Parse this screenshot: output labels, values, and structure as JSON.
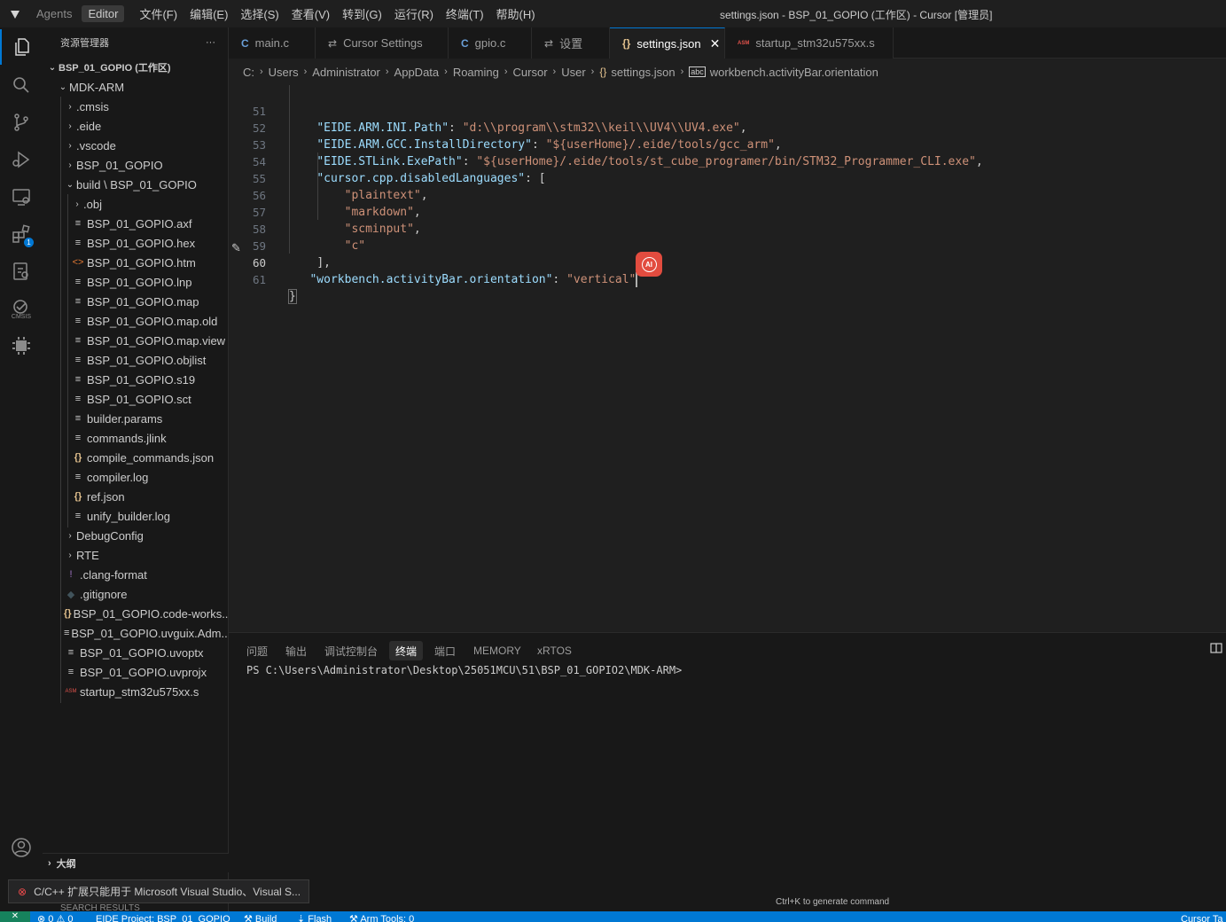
{
  "titlebar": {
    "modes": [
      "Agents",
      "Editor"
    ],
    "menus": [
      "文件(F)",
      "编辑(E)",
      "选择(S)",
      "查看(V)",
      "转到(G)",
      "运行(R)",
      "终端(T)",
      "帮助(H)"
    ],
    "window_title": "settings.json - BSP_01_GOPIO (工作区) - Cursor [管理员]"
  },
  "activitybar": {
    "items": [
      "explorer-icon",
      "search-icon",
      "source-control-icon",
      "run-debug-icon",
      "remote-explorer-icon",
      "extensions-icon",
      "eide-icon",
      "cmsis-icon",
      "chip-icon",
      "account-icon"
    ],
    "extensions_badge": "1",
    "cmsis_label": "CMSIS"
  },
  "sidebar": {
    "title": "资源管理器",
    "more": "···",
    "workspace": "BSP_01_GOPIO (工作区)",
    "tree": [
      {
        "label": "MDK-ARM",
        "chev": "⌄",
        "icon": ""
      },
      {
        "label": ".cmsis",
        "chev": "›",
        "icon": ""
      },
      {
        "label": ".eide",
        "chev": "›",
        "icon": ""
      },
      {
        "label": ".vscode",
        "chev": "›",
        "icon": ""
      },
      {
        "label": "BSP_01_GOPIO",
        "chev": "›",
        "icon": ""
      },
      {
        "label": "build \\ BSP_01_GOPIO",
        "chev": "⌄",
        "icon": ""
      },
      {
        "label": ".obj",
        "chev": "›",
        "icon": ""
      },
      {
        "label": "BSP_01_GOPIO.axf",
        "chev": "",
        "icon": "≡"
      },
      {
        "label": "BSP_01_GOPIO.hex",
        "chev": "",
        "icon": "≡"
      },
      {
        "label": "BSP_01_GOPIO.htm",
        "chev": "",
        "icon": "<>"
      },
      {
        "label": "BSP_01_GOPIO.lnp",
        "chev": "",
        "icon": "≡"
      },
      {
        "label": "BSP_01_GOPIO.map",
        "chev": "",
        "icon": "≡"
      },
      {
        "label": "BSP_01_GOPIO.map.old",
        "chev": "",
        "icon": "≡"
      },
      {
        "label": "BSP_01_GOPIO.map.view",
        "chev": "",
        "icon": "≡"
      },
      {
        "label": "BSP_01_GOPIO.objlist",
        "chev": "",
        "icon": "≡"
      },
      {
        "label": "BSP_01_GOPIO.s19",
        "chev": "",
        "icon": "≡"
      },
      {
        "label": "BSP_01_GOPIO.sct",
        "chev": "",
        "icon": "≡"
      },
      {
        "label": "builder.params",
        "chev": "",
        "icon": "≡"
      },
      {
        "label": "commands.jlink",
        "chev": "",
        "icon": "≡"
      },
      {
        "label": "compile_commands.json",
        "chev": "",
        "icon": "{}"
      },
      {
        "label": "compiler.log",
        "chev": "",
        "icon": "≡"
      },
      {
        "label": "ref.json",
        "chev": "",
        "icon": "{}"
      },
      {
        "label": "unify_builder.log",
        "chev": "",
        "icon": "≡"
      },
      {
        "label": "DebugConfig",
        "chev": "›",
        "icon": ""
      },
      {
        "label": "RTE",
        "chev": "›",
        "icon": ""
      },
      {
        "label": ".clang-format",
        "chev": "",
        "icon": "!"
      },
      {
        "label": ".gitignore",
        "chev": "",
        "icon": "◆"
      },
      {
        "label": "BSP_01_GOPIO.code-works...",
        "chev": "",
        "icon": "{}"
      },
      {
        "label": "BSP_01_GOPIO.uvguix.Adm...",
        "chev": "",
        "icon": "≡"
      },
      {
        "label": "BSP_01_GOPIO.uvoptx",
        "chev": "",
        "icon": "≡"
      },
      {
        "label": "BSP_01_GOPIO.uvprojx",
        "chev": "",
        "icon": "≡"
      },
      {
        "label": "startup_stm32u575xx.s",
        "chev": "",
        "icon": "ASM"
      }
    ],
    "outline_label": "大纲"
  },
  "tabs": [
    {
      "label": "main.c",
      "icon": "C"
    },
    {
      "label": "Cursor Settings",
      "icon": "⇄"
    },
    {
      "label": "gpio.c",
      "icon": "C"
    },
    {
      "label": "设置",
      "icon": "⇄"
    },
    {
      "label": "settings.json",
      "icon": "{}",
      "close": "✕"
    },
    {
      "label": "startup_stm32u575xx.s",
      "icon": "ASM"
    }
  ],
  "breadcrumb": [
    "C:",
    "Users",
    "Administrator",
    "AppData",
    "Roaming",
    "Cursor",
    "User",
    "settings.json",
    "workbench.activityBar.orientation"
  ],
  "editor": {
    "line_numbers": [
      "51",
      "52",
      "53",
      "54",
      "55",
      "56",
      "57",
      "58",
      "59",
      "60",
      "61"
    ],
    "lines": {
      "l51": {
        "indent": "    ",
        "key": "\"EIDE.ARM.INI.Path\"",
        "sep": ": ",
        "value": "\"d:\\\\program\\\\stm32\\\\keil\\\\UV4\\\\UV4.exe\"",
        "end": ","
      },
      "l52": {
        "indent": "    ",
        "key": "\"EIDE.ARM.GCC.InstallDirectory\"",
        "sep": ": ",
        "value": "\"${userHome}/.eide/tools/gcc_arm\"",
        "end": ","
      },
      "l53": {
        "indent": "    ",
        "key": "\"EIDE.STLink.ExePath\"",
        "sep": ": ",
        "value": "\"${userHome}/.eide/tools/st_cube_programer/bin/STM32_Programmer_CLI.exe\"",
        "end": ","
      },
      "l54": {
        "indent": "    ",
        "key": "\"cursor.cpp.disabledLanguages\"",
        "sep": ": ",
        "value": "",
        "end": "["
      },
      "l55": {
        "indent": "        ",
        "value": "\"plaintext\"",
        "end": ","
      },
      "l56": {
        "indent": "        ",
        "value": "\"markdown\"",
        "end": ","
      },
      "l57": {
        "indent": "        ",
        "value": "\"scminput\"",
        "end": ","
      },
      "l58": {
        "indent": "        ",
        "value": "\"c\"",
        "end": ""
      },
      "l59": {
        "indent": "    ",
        "end": "],"
      },
      "l60": {
        "indent": "   ",
        "key": "\"workbench.activityBar.orientation\"",
        "sep": ": ",
        "value": "\"vertical\"",
        "end": ""
      },
      "l61": {
        "end": "}"
      }
    },
    "ai_label": "AI"
  },
  "panel": {
    "tabs": [
      "问题",
      "输出",
      "调试控制台",
      "终端",
      "端口",
      "MEMORY",
      "xRTOS"
    ],
    "active_tab": "终端",
    "terminal_prompt": "PS C:\\Users\\Administrator\\Desktop\\25051MCU\\51\\BSP_01_GOPIO2\\MDK-ARM>",
    "hint": "Ctrl+K to generate command"
  },
  "notification": {
    "text": "C/C++ 扩展只能用于 Microsoft Visual Studio、Visual S...",
    "behind": "SEARCH RESULTS"
  },
  "statusbar": {
    "remote": "✕",
    "problems": "⊗ 0 ⚠ 0",
    "project": "EIDE Project: BSP_01_GOPIO",
    "build": "Build",
    "flash": "Flash",
    "arm_tools": "Arm Tools: 0",
    "right": "Cursor Ta"
  },
  "colors": {
    "accent": "#0078d4",
    "json_key": "#9cdcfe",
    "json_string": "#ce9178",
    "ai_button": "#e24c3f"
  }
}
